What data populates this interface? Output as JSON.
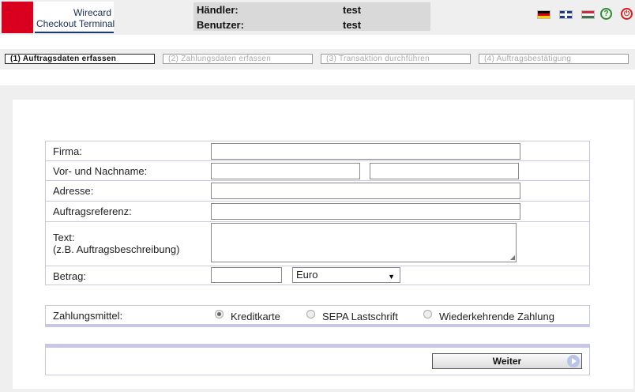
{
  "header": {
    "logo_line1": "Wirecard",
    "logo_line2": "Checkout Terminal",
    "merchant_label": "Händler:",
    "merchant_value": "test",
    "user_label": "Benutzer:",
    "user_value": "test",
    "icons": [
      "flag-de-icon",
      "flag-gb-icon",
      "flag-hu-icon",
      "help-icon",
      "power-icon"
    ],
    "help_glyph": "?",
    "power_glyph": "⏻"
  },
  "steps": [
    {
      "label": "(1)  Auftragsdaten erfassen",
      "active": true
    },
    {
      "label": "(2)  Zahlungsdaten erfassen",
      "active": false
    },
    {
      "label": "(3)  Transaktion durchführen",
      "active": false
    },
    {
      "label": "(4)  Auftragsbestätigung",
      "active": false
    }
  ],
  "form": {
    "company_label": "Firma:",
    "company_value": "",
    "name_label": "Vor- und Nachname:",
    "firstname_value": "",
    "lastname_value": "",
    "address_label": "Adresse:",
    "address_value": "",
    "reference_label": "Auftragsreferenz:",
    "reference_value": "",
    "text_label_line1": "Text:",
    "text_label_line2": "(z.B. Auftragsbeschreibung)",
    "text_value": "",
    "amount_label": "Betrag:",
    "amount_value": "",
    "currency_selected": "Euro"
  },
  "payment": {
    "label": "Zahlungsmittel:",
    "options": [
      {
        "label": "Kreditkarte",
        "checked": true
      },
      {
        "label": "SEPA Lastschrift",
        "checked": false
      },
      {
        "label": "Wiederkehrende Zahlung",
        "checked": false
      }
    ]
  },
  "footer": {
    "next_label": "Weiter"
  },
  "colors": {
    "brand_red": "#d8001e",
    "brand_navy": "#1a3b6d",
    "form_border": "#c8c8e6"
  }
}
